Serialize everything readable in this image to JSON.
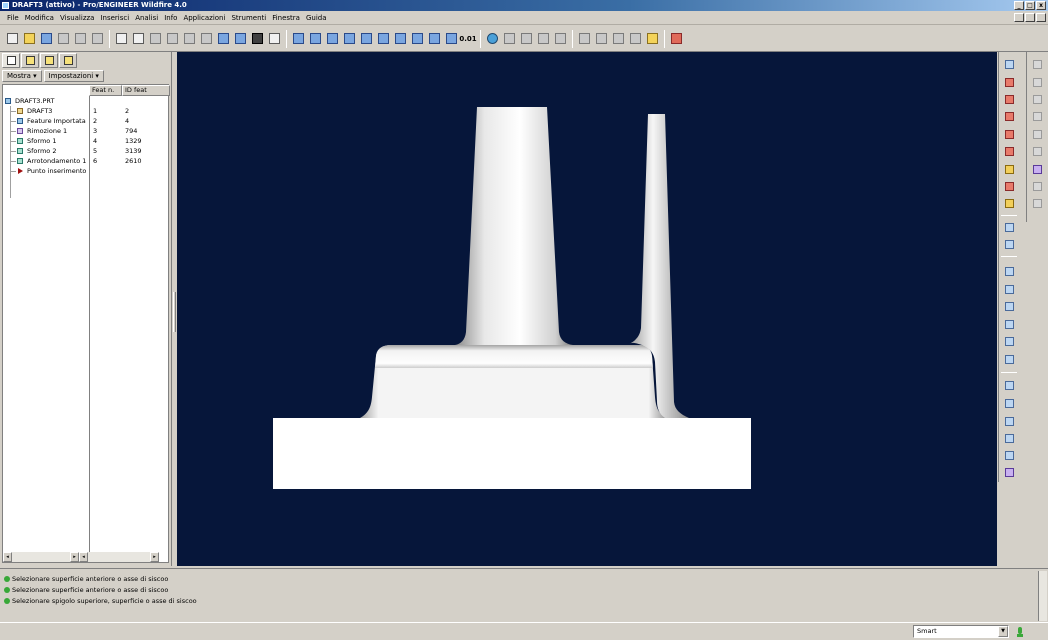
{
  "window": {
    "title": "DRAFT3 (attivo) - Pro/ENGINEER Wildfire 4.0",
    "controls": [
      "_",
      "□",
      "x"
    ]
  },
  "menu": [
    "File",
    "Modifica",
    "Visualizza",
    "Inserisci",
    "Analisi",
    "Info",
    "Applicazioni",
    "Strumenti",
    "Finestra",
    "Guida"
  ],
  "toolbar": {
    "precision_label": "0.01"
  },
  "left_panel": {
    "show_button": "Mostra ▾",
    "settings_button": "Impostazioni ▾",
    "columns": [
      "Feat n.",
      "ID feat"
    ],
    "tree": [
      {
        "label": "DRAFT3.PRT",
        "num": "",
        "id": ""
      },
      {
        "label": "DRAFT3",
        "num": "1",
        "id": "2"
      },
      {
        "label": "Feature Importata",
        "num": "2",
        "id": "4"
      },
      {
        "label": "Rimozione 1",
        "num": "3",
        "id": "794"
      },
      {
        "label": "Sformo 1",
        "num": "4",
        "id": "1329"
      },
      {
        "label": "Sformo 2",
        "num": "5",
        "id": "3139"
      },
      {
        "label": "Arrotondamento 1",
        "num": "6",
        "id": "2610"
      },
      {
        "label": "Punto inserimento",
        "num": "",
        "id": ""
      }
    ]
  },
  "messages": [
    "Selezionare superficie anteriore o asse di siscoo",
    "Selezionare superficie anteriore o asse di siscoo",
    "Selezionare spigolo superiore, superficie o asse di siscoo"
  ],
  "status": {
    "filter_value": "Smart"
  },
  "colors": {
    "viewport_bg": "#06163a",
    "title_bar": "#0a246a",
    "ui_face": "#d4d0c8"
  }
}
